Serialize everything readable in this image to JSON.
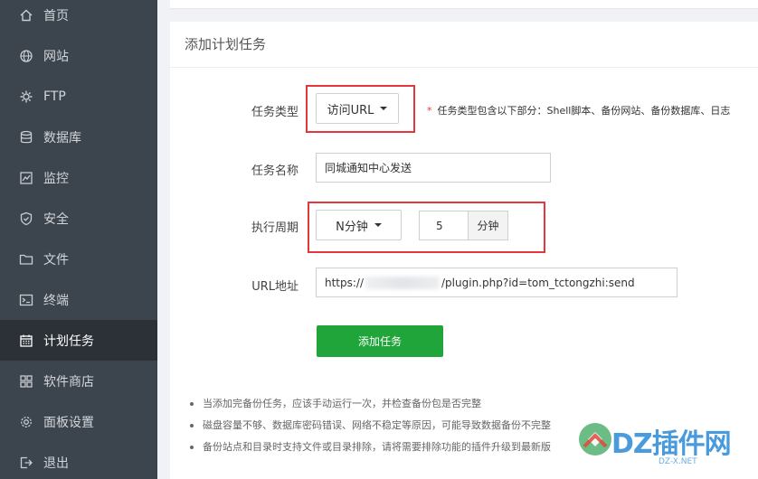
{
  "sidebar": {
    "items": [
      {
        "label": "首页",
        "icon": "home-icon",
        "active": false
      },
      {
        "label": "网站",
        "icon": "globe-icon",
        "active": false
      },
      {
        "label": "FTP",
        "icon": "ftp-icon",
        "active": false
      },
      {
        "label": "数据库",
        "icon": "database-icon",
        "active": false
      },
      {
        "label": "监控",
        "icon": "monitor-icon",
        "active": false
      },
      {
        "label": "安全",
        "icon": "shield-icon",
        "active": false
      },
      {
        "label": "文件",
        "icon": "folder-icon",
        "active": false
      },
      {
        "label": "终端",
        "icon": "terminal-icon",
        "active": false
      },
      {
        "label": "计划任务",
        "icon": "calendar-icon",
        "active": true
      },
      {
        "label": "软件商店",
        "icon": "grid-icon",
        "active": false
      },
      {
        "label": "面板设置",
        "icon": "gear-icon",
        "active": false
      },
      {
        "label": "退出",
        "icon": "logout-icon",
        "active": false
      }
    ]
  },
  "form": {
    "title": "添加计划任务",
    "task_type": {
      "label": "任务类型",
      "value": "访问URL",
      "hint_star": "*",
      "hint": "任务类型包含以下部分：Shell脚本、备份网站、备份数据库、日志"
    },
    "task_name": {
      "label": "任务名称",
      "value": "同城通知中心发送"
    },
    "cycle": {
      "label": "执行周期",
      "value": "N分钟",
      "amount": "5",
      "unit": "分钟"
    },
    "url": {
      "label": "URL地址",
      "prefix": "https://",
      "suffix": "/plugin.php?id=tom_tctongzhi:send"
    },
    "submit_label": "添加任务"
  },
  "notes": [
    "当添加完备份任务，应该手动运行一次，并检查备份包是否完整",
    "磁盘容量不够、数据库密码错误、网络不稳定等原因，可能导致数据备份不完整",
    "备份站点和目录时支持文件或目录排除，请将需要排除功能的插件升级到最新版"
  ],
  "watermark": {
    "text": "DZ插件网",
    "sub": "DZ-X.NET"
  },
  "colors": {
    "sidebar_bg": "#3c444d",
    "sidebar_active": "#2c3138",
    "accent_green": "#20a53a",
    "highlight_red": "#e5373b"
  }
}
